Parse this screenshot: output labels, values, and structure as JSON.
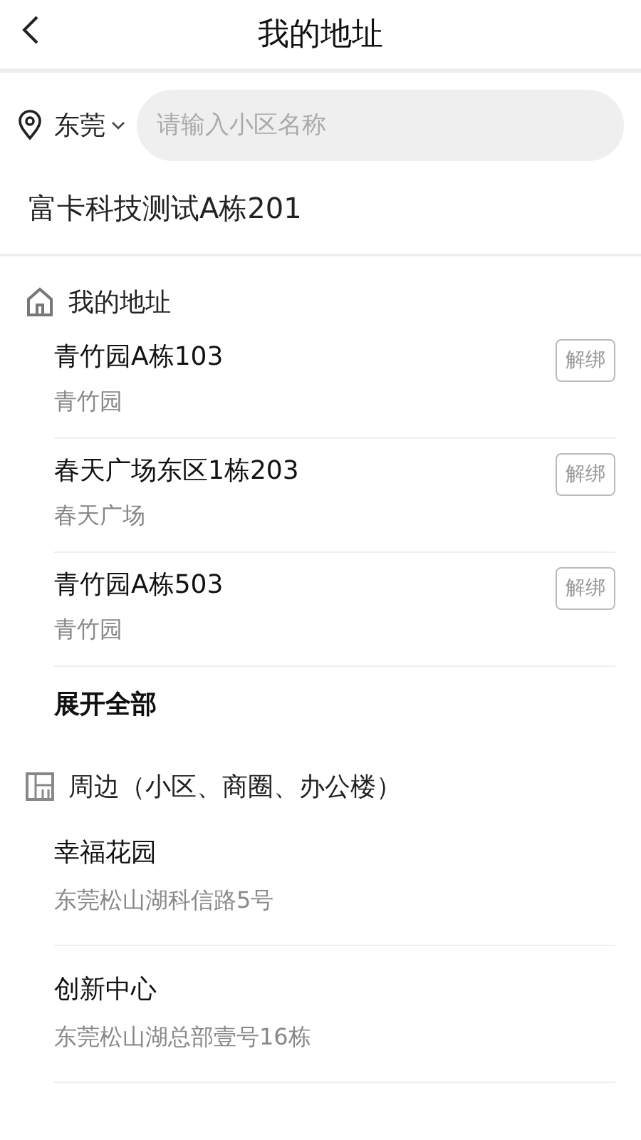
{
  "header": {
    "title": "我的地址"
  },
  "location": {
    "city": "东莞"
  },
  "search": {
    "placeholder": "请输入小区名称"
  },
  "current_address": "富卡科技测试A栋201",
  "my_addresses": {
    "title": "我的地址",
    "items": [
      {
        "name": "青竹园A栋103",
        "community": "青竹园",
        "action": "解绑"
      },
      {
        "name": "春天广场东区1栋203",
        "community": "春天广场",
        "action": "解绑"
      },
      {
        "name": "青竹园A栋503",
        "community": "青竹园",
        "action": "解绑"
      }
    ],
    "expand": "展开全部"
  },
  "nearby": {
    "title": "周边（小区、商圈、办公楼）",
    "items": [
      {
        "name": "幸福花园",
        "address": "东莞松山湖科信路5号"
      },
      {
        "name": "创新中心",
        "address": "东莞松山湖总部壹号16栋"
      }
    ]
  }
}
